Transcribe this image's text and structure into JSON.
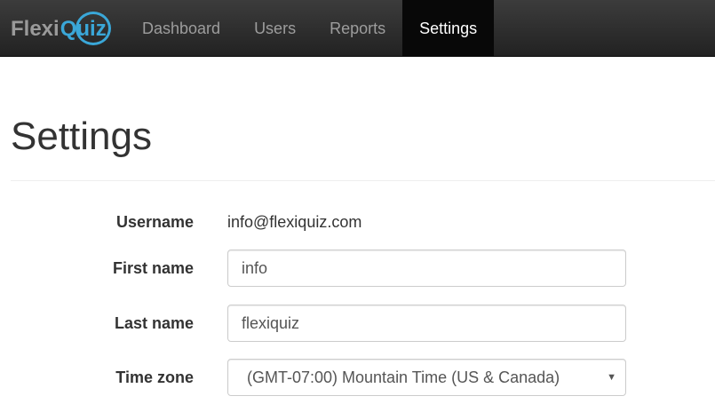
{
  "navbar": {
    "brand_flexi": "Flexi",
    "brand_quiz": "Quiz",
    "items": [
      {
        "label": "Dashboard",
        "active": false
      },
      {
        "label": "Users",
        "active": false
      },
      {
        "label": "Reports",
        "active": false
      },
      {
        "label": "Settings",
        "active": true
      }
    ],
    "brand_color": "#3aa7d8"
  },
  "page": {
    "title": "Settings"
  },
  "form": {
    "username_label": "Username",
    "username_value": "info@flexiquiz.com",
    "first_name_label": "First name",
    "first_name_value": "info",
    "last_name_label": "Last name",
    "last_name_value": "flexiquiz",
    "time_zone_label": "Time zone",
    "time_zone_value": "(GMT-07:00) Mountain Time (US & Canada)",
    "caret_icon": "caret-down-icon"
  }
}
